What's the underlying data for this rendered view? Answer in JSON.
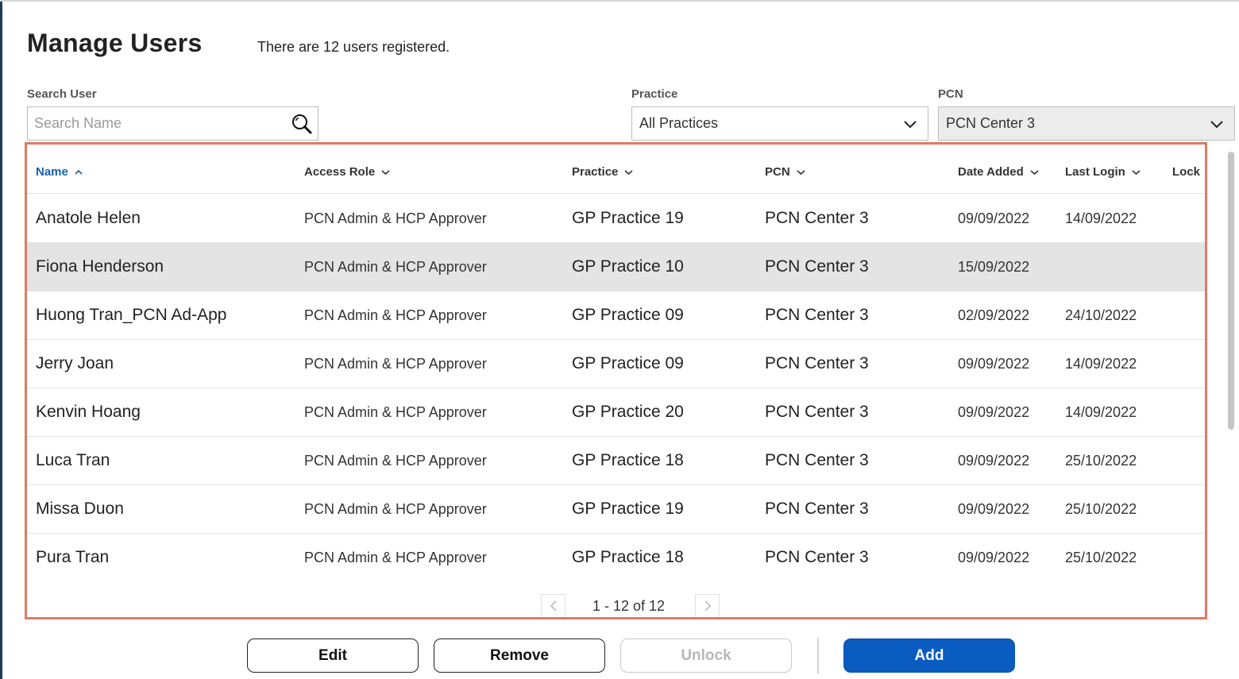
{
  "page": {
    "title": "Manage Users",
    "user_count_text": "There are 12 users registered."
  },
  "filters": {
    "search_label": "Search User",
    "search_placeholder": "Search Name",
    "search_value": "",
    "practice_label": "Practice",
    "practice_value": "All Practices",
    "pcn_label": "PCN",
    "pcn_value": "PCN Center 3"
  },
  "table": {
    "columns": [
      {
        "label": "Name",
        "sort": "ascending"
      },
      {
        "label": "Access Role",
        "sort": "dropdown"
      },
      {
        "label": "Practice",
        "sort": "dropdown"
      },
      {
        "label": "PCN",
        "sort": "dropdown"
      },
      {
        "label": "Date Added",
        "sort": "dropdown"
      },
      {
        "label": "Last Login",
        "sort": "dropdown"
      },
      {
        "label": "Lock",
        "sort": "none"
      }
    ],
    "rows": [
      {
        "name": "Anatole Helen",
        "role": "PCN Admin & HCP Approver",
        "practice": "GP Practice 19",
        "pcn": "PCN Center 3",
        "date_added": "09/09/2022",
        "last_login": "14/09/2022"
      },
      {
        "name": "Fiona Henderson",
        "role": "PCN Admin & HCP Approver",
        "practice": "GP Practice 10",
        "pcn": "PCN Center 3",
        "date_added": "15/09/2022",
        "last_login": ""
      },
      {
        "name": "Huong Tran_PCN Ad-App",
        "role": "PCN Admin & HCP Approver",
        "practice": "GP Practice 09",
        "pcn": "PCN Center 3",
        "date_added": "02/09/2022",
        "last_login": "24/10/2022"
      },
      {
        "name": "Jerry Joan",
        "role": "PCN Admin & HCP Approver",
        "practice": "GP Practice 09",
        "pcn": "PCN Center 3",
        "date_added": "09/09/2022",
        "last_login": "14/09/2022"
      },
      {
        "name": "Kenvin Hoang",
        "role": "PCN Admin & HCP Approver",
        "practice": "GP Practice 20",
        "pcn": "PCN Center 3",
        "date_added": "09/09/2022",
        "last_login": "14/09/2022"
      },
      {
        "name": "Luca Tran",
        "role": "PCN Admin & HCP Approver",
        "practice": "GP Practice 18",
        "pcn": "PCN Center 3",
        "date_added": "09/09/2022",
        "last_login": "25/10/2022"
      },
      {
        "name": "Missa Duon",
        "role": "PCN Admin & HCP Approver",
        "practice": "GP Practice 19",
        "pcn": "PCN Center 3",
        "date_added": "09/09/2022",
        "last_login": "25/10/2022"
      },
      {
        "name": "Pura Tran",
        "role": "PCN Admin & HCP Approver",
        "practice": "GP Practice 18",
        "pcn": "PCN Center 3",
        "date_added": "09/09/2022",
        "last_login": "25/10/2022"
      }
    ],
    "highlighted_row": 1
  },
  "pagination": {
    "text": "1 - 12 of 12",
    "prev_icon": "chevron-left-icon",
    "next_icon": "chevron-right-icon"
  },
  "actions": {
    "edit_label": "Edit",
    "remove_label": "Remove",
    "unlock_label": "Unlock",
    "add_label": "Add"
  },
  "colors": {
    "accent": "#0a5cc0",
    "active_header": "#1b5fb0",
    "selection_outline": "#e07a62",
    "row_highlight": "#e4e4e4"
  }
}
